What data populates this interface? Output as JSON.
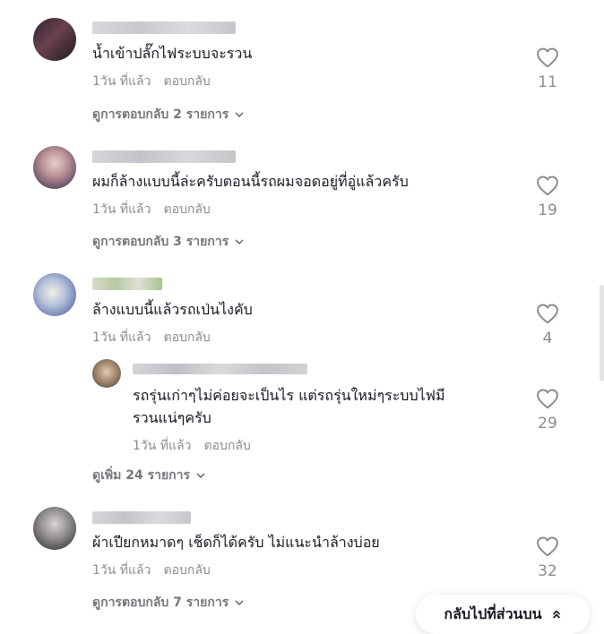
{
  "comments": [
    {
      "text": "น้ำเข้าปลั๊กไฟระบบจะรวน",
      "time": "1วัน ที่แล้ว",
      "reply_label": "ตอบกลับ",
      "likes": "11",
      "view_replies": "ดูการตอบกลับ 2 รายการ"
    },
    {
      "text": "ผมก็ล้างแบบนี้ล่ะครับตอนนี้รถผมจอดอยู่ที่อู่แล้วครับ",
      "time": "1วัน ที่แล้ว",
      "reply_label": "ตอบกลับ",
      "likes": "19",
      "view_replies": "ดูการตอบกลับ 3 รายการ"
    },
    {
      "text": "ล้างแบบนี้แล้วรถเป่นไงคับ",
      "time": "1วัน ที่แล้ว",
      "reply_label": "ตอบกลับ",
      "likes": "4",
      "reply": {
        "text_line1": "รถรุ่นเก่าๆไม่ค่อยจะเป็นไร แต่รถรุ่นใหม่ๆระบบไฟมี",
        "text_line2": "รวนแน่ๆครับ",
        "time": "1วัน ที่แล้ว",
        "reply_label": "ตอบกลับ",
        "likes": "29"
      },
      "view_more": "ดูเพิ่ม 24 รายการ"
    },
    {
      "text": "ผ้าเปียกหมาดๆ เช็ดก็ได้ครับ ไม่แนะนำล้างบ่อย",
      "time": "1วัน ที่แล้ว",
      "reply_label": "ตอบกลับ",
      "likes": "32",
      "view_replies": "ดูการตอบกลับ 7 รายการ"
    }
  ],
  "back_to_top": "กลับไปที่ส่วนบน",
  "icons": [
    "heart-outline-icon",
    "chevron-down-icon",
    "chevron-double-up-icon"
  ],
  "colors": {
    "text": "#161823",
    "muted": "#8a8b91",
    "link": "#75767d"
  }
}
